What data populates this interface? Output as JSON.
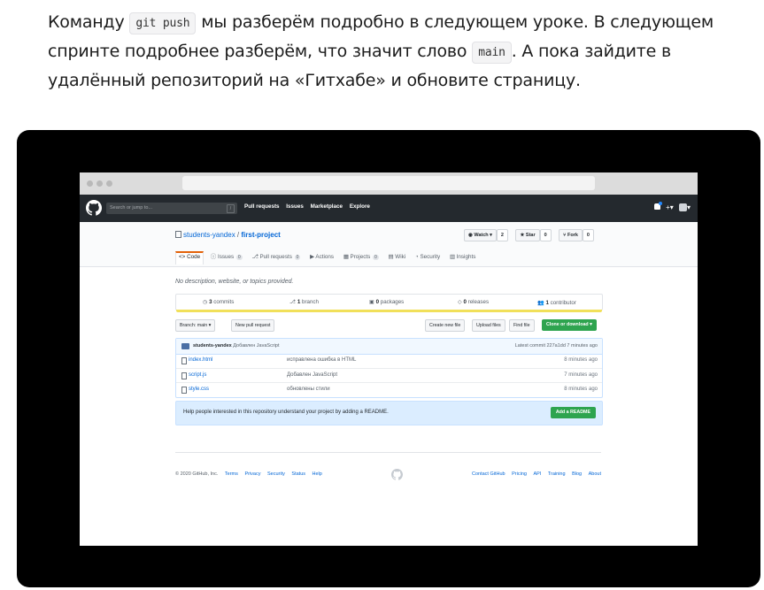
{
  "lesson": {
    "t1": "Команду ",
    "code1": "git push",
    "t2": " мы разберём подробно в следующем уроке. В следующем спринте подробнее разберём, что значит слово ",
    "code2": "main",
    "t3": ". А пока зайдите в удалённый репозиторий на «Гитхабе» и обновите страницу."
  },
  "header": {
    "search_placeholder": "Search or jump to...",
    "search_key": "/",
    "nav": [
      "Pull requests",
      "Issues",
      "Marketplace",
      "Explore"
    ],
    "plus": "+▾",
    "avatar_caret": "▾"
  },
  "repo": {
    "owner": "students-yandex",
    "sep": " / ",
    "name": "first-project",
    "watch_label": "◉ Watch ▾",
    "watch_count": "2",
    "star_label": "★ Star",
    "star_count": "0",
    "fork_label": "⑂ Fork",
    "fork_count": "0"
  },
  "tabs": [
    {
      "label": "<> Code",
      "count": ""
    },
    {
      "label": "ⓘ Issues",
      "count": "0"
    },
    {
      "label": "⎇ Pull requests",
      "count": "0"
    },
    {
      "label": "▶ Actions",
      "count": ""
    },
    {
      "label": "▦ Projects",
      "count": "0"
    },
    {
      "label": "▤ Wiki",
      "count": ""
    },
    {
      "label": "◔ Security",
      "count": ""
    },
    {
      "label": "▥ Insights",
      "count": ""
    }
  ],
  "main": {
    "description": "No description, website, or topics provided.",
    "commits_n": "3",
    "commits_label": " commits",
    "branch_n": "1",
    "branch_label": " branch",
    "packages_n": "0",
    "packages_label": " packages",
    "releases_n": "0",
    "releases_label": " releases",
    "contrib_n": "1",
    "contrib_label": " contributor",
    "branch_btn": "Branch: main ▾",
    "new_pr": "New pull request",
    "create_file": "Create new file",
    "upload_files": "Upload files",
    "find_file": "Find file",
    "clone": "Clone or download ▾"
  },
  "commit": {
    "author": "students-yandex",
    "message": "Добавлен JavaScript",
    "latest": "Latest commit 227a1dd 7 minutes ago"
  },
  "files": [
    {
      "name": "index.html",
      "msg": "исправлена ошибка в HTML",
      "age": "8 minutes ago"
    },
    {
      "name": "script.js",
      "msg": "Добавлен JavaScript",
      "age": "7 minutes ago"
    },
    {
      "name": "style.css",
      "msg": "обновлены стили",
      "age": "8 minutes ago"
    }
  ],
  "readme": {
    "text": "Help people interested in this repository understand your project by adding a README.",
    "button": "Add a README"
  },
  "footer": {
    "copyright": "© 2020 GitHub, Inc.",
    "left_links": [
      "Terms",
      "Privacy",
      "Security",
      "Status",
      "Help"
    ],
    "right_links": [
      "Contact GitHub",
      "Pricing",
      "API",
      "Training",
      "Blog",
      "About"
    ]
  }
}
